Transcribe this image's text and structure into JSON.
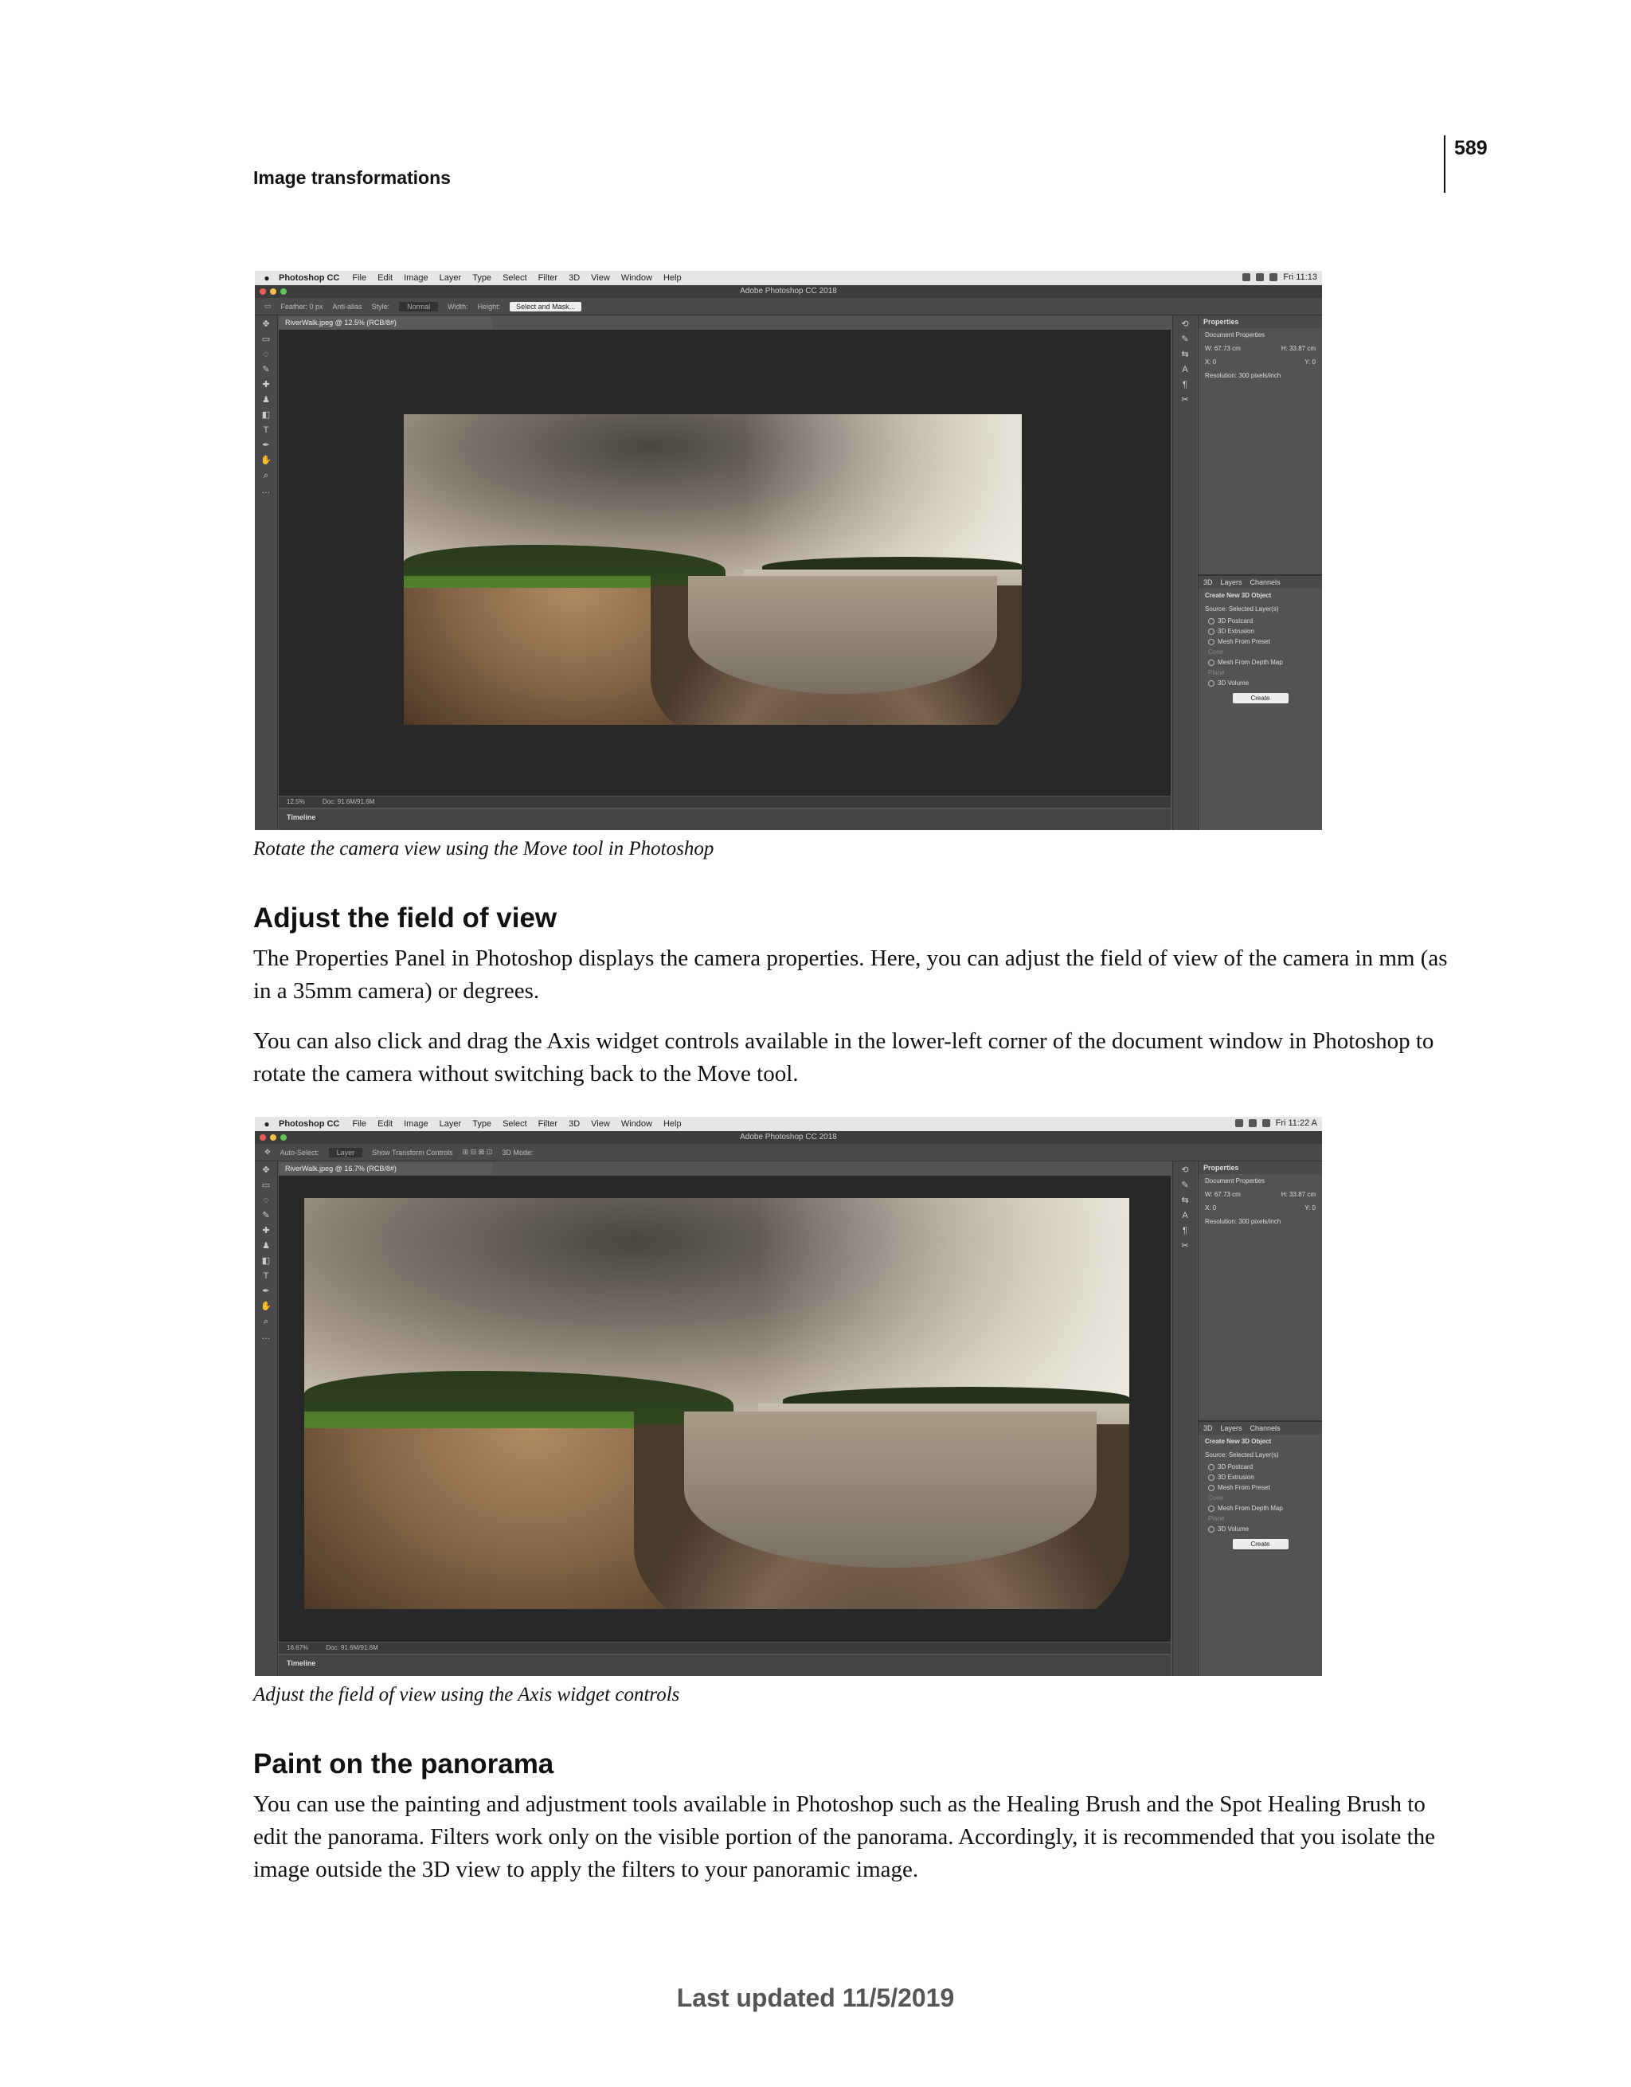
{
  "header": {
    "page_number": "589",
    "running_title": "Image transformations"
  },
  "figures": [
    {
      "caption": "Rotate the camera view using the Move tool in Photoshop",
      "window_title": "Adobe Photoshop CC 2018",
      "menu": [
        "Photoshop CC",
        "File",
        "Edit",
        "Image",
        "Layer",
        "Type",
        "Select",
        "Filter",
        "3D",
        "View",
        "Window",
        "Help"
      ],
      "clock": "Fri 11:13",
      "doc_tab": "RiverWalk.jpeg @ 12.5% (RCB/8#)",
      "options": [
        "Feather: 0 px",
        "Anti-alias",
        "Style:",
        "Normal",
        "Width:",
        "Height:"
      ],
      "select_button": "Select and Mask...",
      "zoom": "12.5%",
      "doc_size": "Doc: 91.6M/91.6M",
      "timeline": "Timeline"
    },
    {
      "caption": "Adjust the field of view using the Axis widget controls",
      "window_title": "Adobe Photoshop CC 2018",
      "menu": [
        "Photoshop CC",
        "File",
        "Edit",
        "Image",
        "Layer",
        "Type",
        "Select",
        "Filter",
        "3D",
        "View",
        "Window",
        "Help"
      ],
      "clock": "Fri 11:22 A",
      "doc_tab": "RiverWalk.jpeg @ 16.7% (RCB/8#)",
      "options": [
        "Auto-Select:",
        "Layer",
        "Show Transform Controls",
        "3D Mode:"
      ],
      "zoom": "16.67%",
      "doc_size": "Doc: 91.6M/91.6M",
      "timeline": "Timeline"
    }
  ],
  "panel": {
    "title": "Properties",
    "doc_props": "Document Properties",
    "w": "W: 67.73 cm",
    "h": "H: 33.87 cm",
    "x": "X: 0",
    "y": "Y: 0",
    "resolution": "Resolution: 300 pixels/inch",
    "tabs": [
      "3D",
      "Layers",
      "Channels"
    ],
    "create_heading": "Create New 3D Object",
    "source_label": "Source:",
    "source_value": "Selected Layer(s)",
    "options": [
      "3D Postcard",
      "3D Extrusion",
      "Mesh From Preset",
      "Cone",
      "Mesh From Depth Map",
      "Plane",
      "3D Volume"
    ],
    "create_button": "Create"
  },
  "sections": [
    {
      "heading": "Adjust the field of view",
      "paragraphs": [
        "The Properties Panel in Photoshop displays the camera properties. Here, you can adjust the field of view of the camera in mm (as in a 35mm camera) or degrees.",
        "You can also click and drag the Axis widget controls available in the lower-left corner of the document window in Photoshop to rotate the camera without switching back to the Move tool."
      ]
    },
    {
      "heading": "Paint on the panorama",
      "paragraphs": [
        "You can use the painting and adjustment tools available in Photoshop such as the Healing Brush and the Spot Healing Brush to edit the panorama. Filters work only on the visible portion of the panorama. Accordingly, it is recommended that you isolate the image outside the 3D view to apply the filters to your panoramic image."
      ]
    }
  ],
  "footer": "Last updated 11/5/2019",
  "colors": {
    "ui_dark": "#535353",
    "canvas": "#282828"
  }
}
